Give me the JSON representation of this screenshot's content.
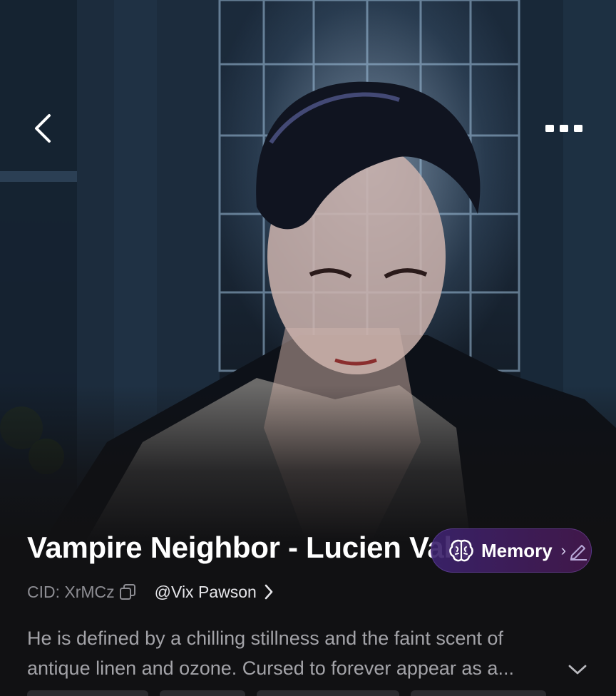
{
  "header": {
    "back_icon": "chevron-left-icon",
    "more_icon": "ellipsis-icon"
  },
  "character": {
    "title": "Vampire Neighbor - Lucien Valmont",
    "cid": "CID: XrMCz",
    "creator": "@Vix Pawson",
    "description_line1": "He is defined by a chilling stillness and the faint scent of",
    "description_line2": "antique linen and ozone. Cursed to forever appear as a..."
  },
  "memory": {
    "label": "Memory",
    "icon": "brain-icon",
    "edit_icon": "edit-pencil-icon"
  },
  "colors": {
    "background": "#111113",
    "title": "#ffffff",
    "muted": "#8d8d93",
    "body_text": "#a3a3a8",
    "memory_pill": "#3c236e"
  }
}
